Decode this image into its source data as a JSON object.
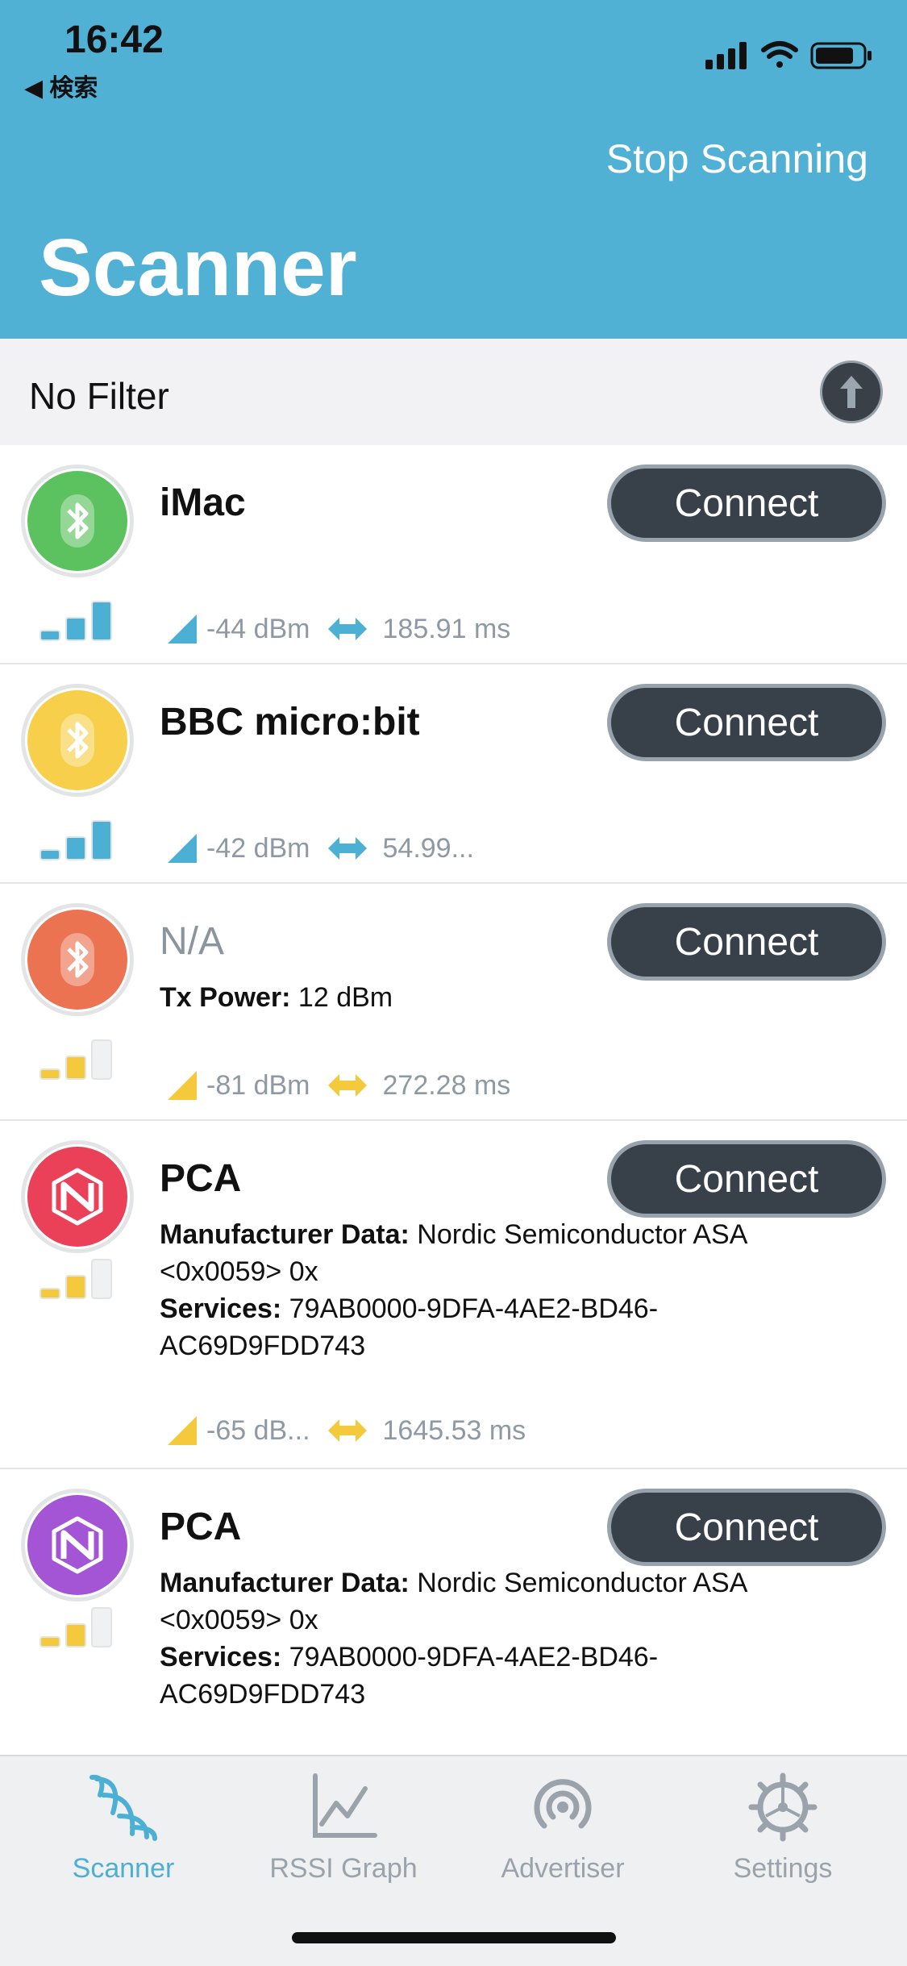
{
  "status_bar": {
    "time": "16:42",
    "back_label": "◀ 検索"
  },
  "header": {
    "stop_label": "Stop Scanning",
    "title": "Scanner"
  },
  "filter": {
    "label": "No Filter"
  },
  "devices": [
    {
      "name": "iMac",
      "connect_label": "Connect",
      "rssi": "-44 dBm",
      "interval": "185.91 ms",
      "color": "#5cc25f"
    },
    {
      "name": "BBC micro:bit",
      "connect_label": "Connect",
      "rssi": "-42 dBm",
      "interval": "54.99...",
      "color": "#f7cf4a"
    },
    {
      "name": "N/A",
      "connect_label": "Connect",
      "tx_label": "Tx Power:",
      "tx_value": " 12 dBm",
      "rssi": "-81 dBm",
      "interval": "272.28 ms",
      "color": "#ec7352"
    },
    {
      "name": "PCA",
      "connect_label": "Connect",
      "mfr_label": "Manufacturer Data:",
      "mfr_value": " Nordic Semiconductor ASA <0x0059> 0x",
      "svc_label": "Services:",
      "svc_value": " 79AB0000-9DFA-4AE2-BD46-AC69D9FDD743",
      "rssi": "-65 dB...",
      "interval": "1645.53 ms",
      "color": "#ea4159"
    },
    {
      "name": "PCA",
      "connect_label": "Connect",
      "mfr_label": "Manufacturer Data:",
      "mfr_value": " Nordic Semiconductor ASA <0x0059> 0x",
      "svc_label": "Services:",
      "svc_value": " 79AB0000-9DFA-4AE2-BD46-AC69D9FDD743",
      "color": "#a355d6"
    }
  ],
  "tabs": [
    {
      "label": "Scanner",
      "icon": "scanner-icon",
      "active": true
    },
    {
      "label": "RSSI Graph",
      "icon": "graph-icon"
    },
    {
      "label": "Advertiser",
      "icon": "advertiser-icon"
    },
    {
      "label": "Settings",
      "icon": "gear-icon"
    }
  ],
  "colors": {
    "accent": "#50b1d5",
    "signal_strong": "#4bb0d4",
    "signal_weak": "#f4c93c"
  }
}
